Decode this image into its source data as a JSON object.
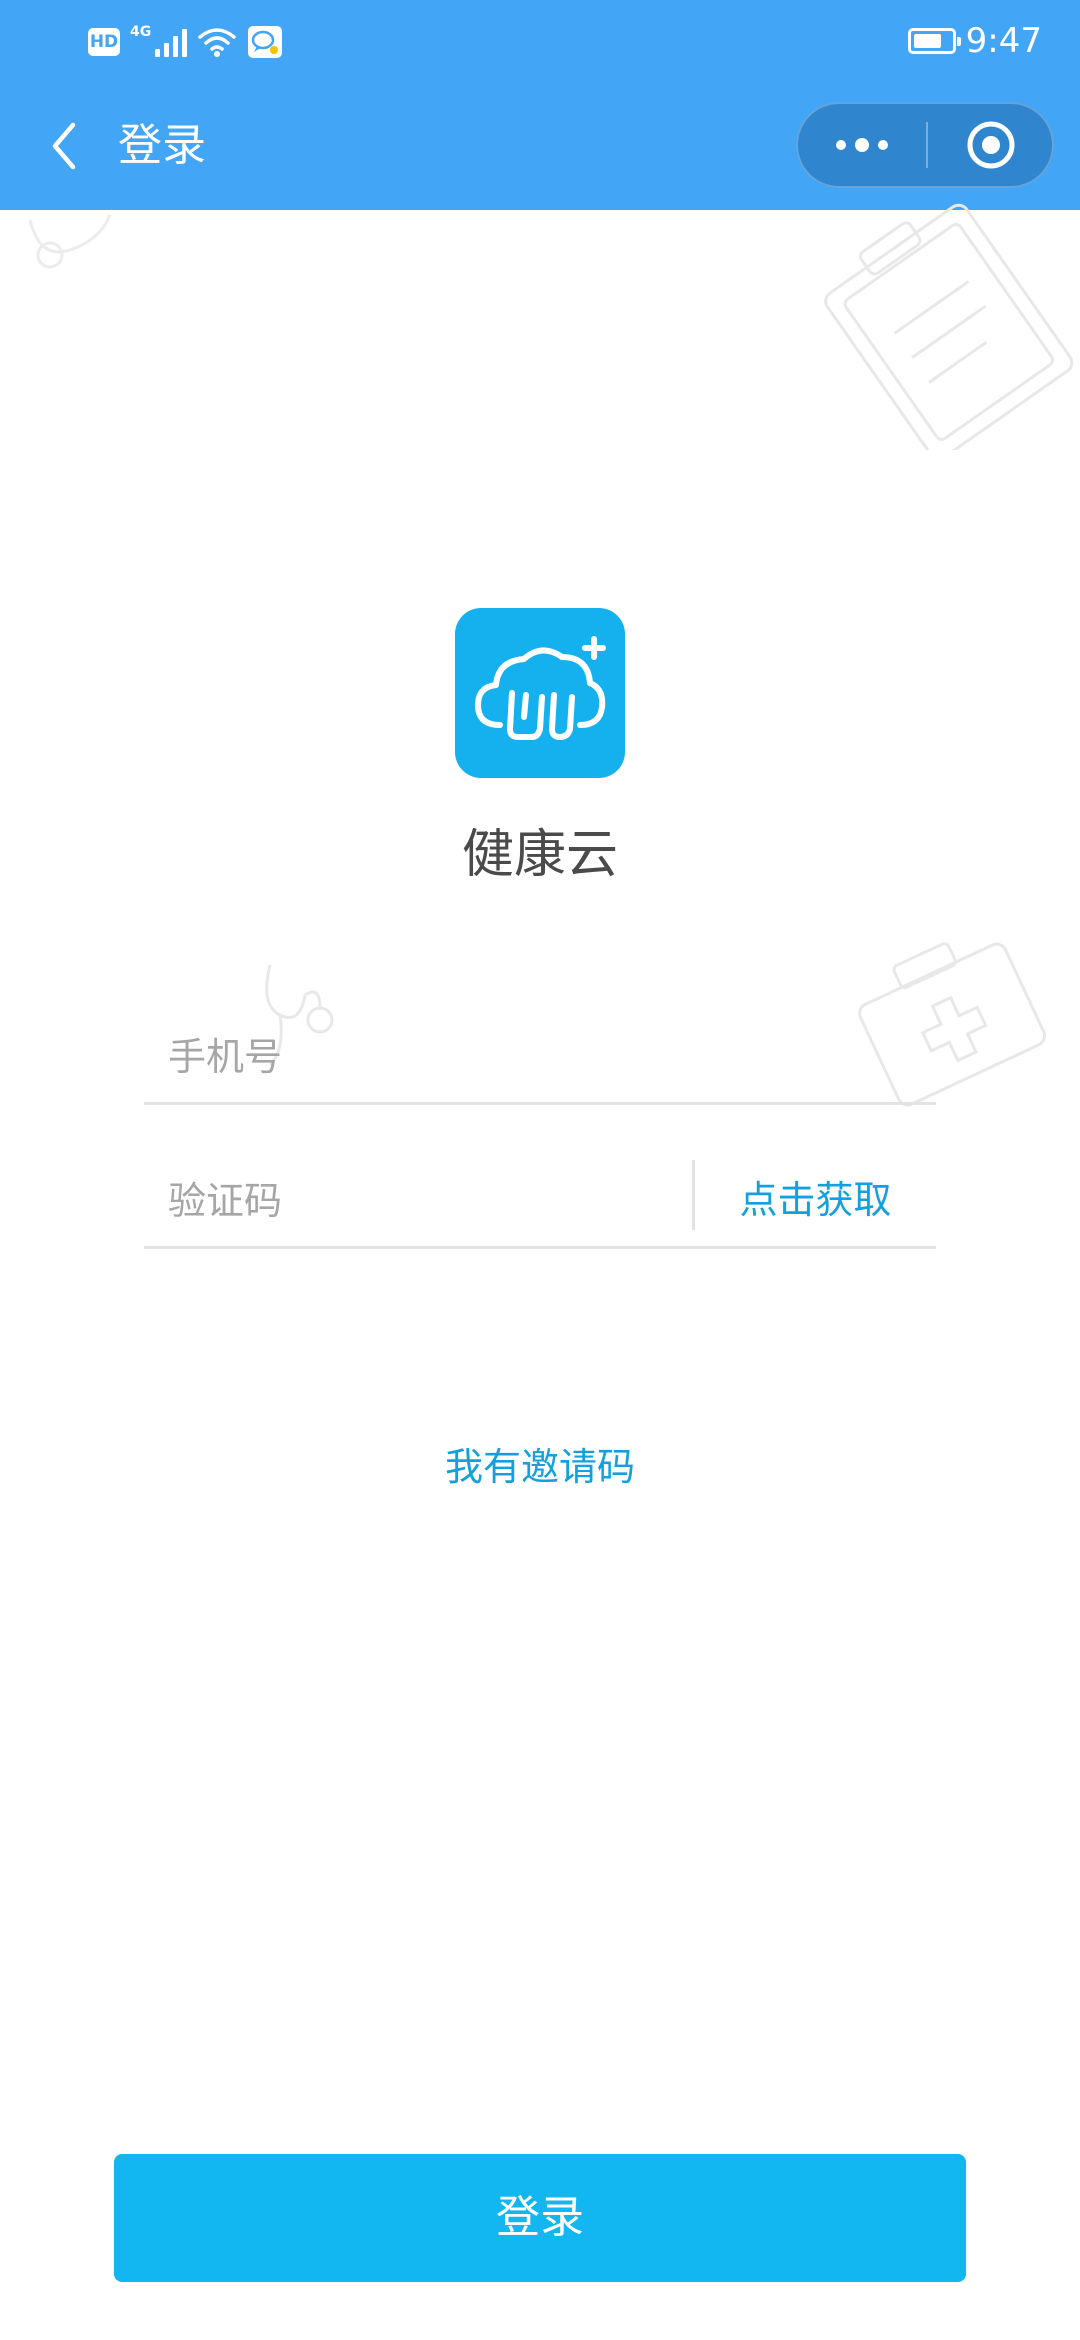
{
  "status_bar": {
    "hd_badge": "HD",
    "network": "4G",
    "time": "9:47",
    "battery_level": 0.75
  },
  "nav": {
    "title": "登录"
  },
  "app": {
    "name": "健康云"
  },
  "form": {
    "phone_placeholder": "手机号",
    "code_placeholder": "验证码",
    "get_code_label": "点击获取",
    "invite_label": "我有邀请码",
    "login_label": "登录"
  },
  "colors": {
    "primary_bar": "#42a5f5",
    "accent": "#14a0dc",
    "login_button": "#12b6f1",
    "logo_bg": "#15b1ef"
  }
}
